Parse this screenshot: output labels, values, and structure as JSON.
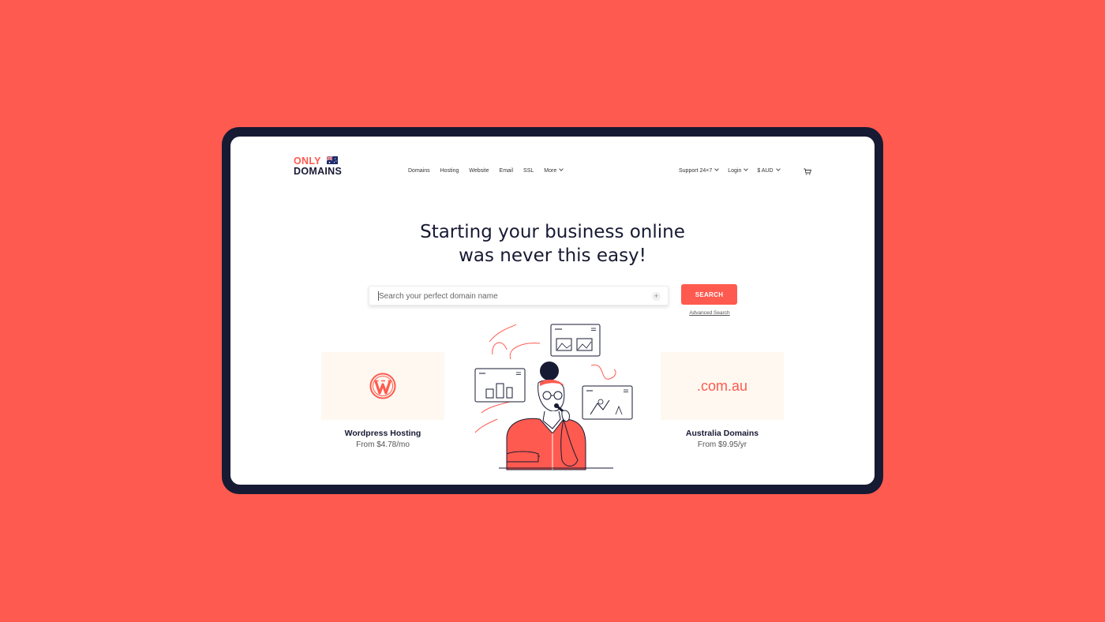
{
  "brand": {
    "line1": "ONLY",
    "line2": "DOMAINS",
    "flag_icon": "australia-flag-icon"
  },
  "nav": {
    "items": [
      "Domains",
      "Hosting",
      "Website",
      "Email",
      "SSL",
      "More"
    ]
  },
  "right_nav": {
    "support": "Support 24×7",
    "login": "Login",
    "currency": "$ AUD"
  },
  "hero": {
    "line1": "Starting your business online",
    "line2": "was never this easy!"
  },
  "search": {
    "placeholder": "Search your perfect domain name",
    "button": "SEARCH",
    "advanced": "Advanced Search"
  },
  "cards": [
    {
      "title": "Wordpress Hosting",
      "price": "From $4.78/mo",
      "icon": "wordpress-icon"
    },
    {
      "title": "Australia Domains",
      "price": "From $9.95/yr",
      "tld": ".com.au"
    }
  ],
  "colors": {
    "background": "#ff5a4f",
    "accent": "#ff5a4f",
    "dark": "#171a33",
    "card_bg": "#fff8f0"
  }
}
